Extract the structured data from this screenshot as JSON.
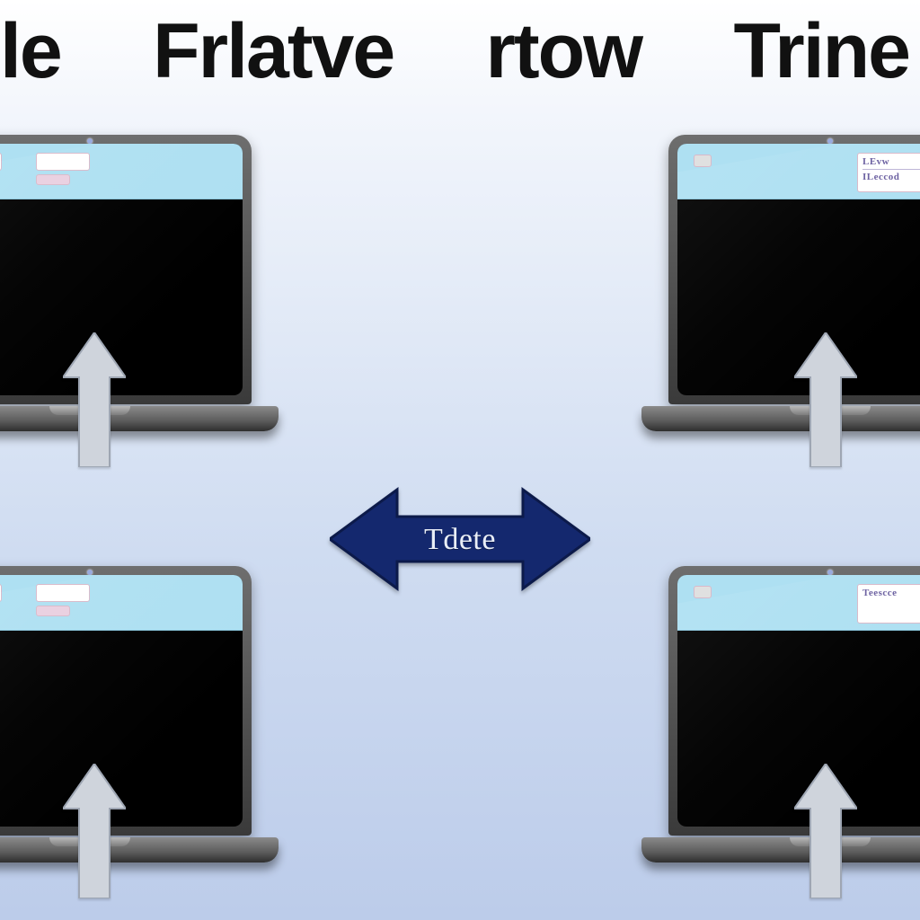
{
  "title": {
    "words": [
      "le",
      "Frlatve",
      "rtow",
      "Trine"
    ]
  },
  "center_arrow": {
    "label": "Tdete"
  },
  "laptops": {
    "top_right_tab": {
      "line1": "LEvw",
      "line2": "ILeccod"
    },
    "bottom_right_tab": {
      "line1": "Teescce",
      "line2": ""
    }
  }
}
